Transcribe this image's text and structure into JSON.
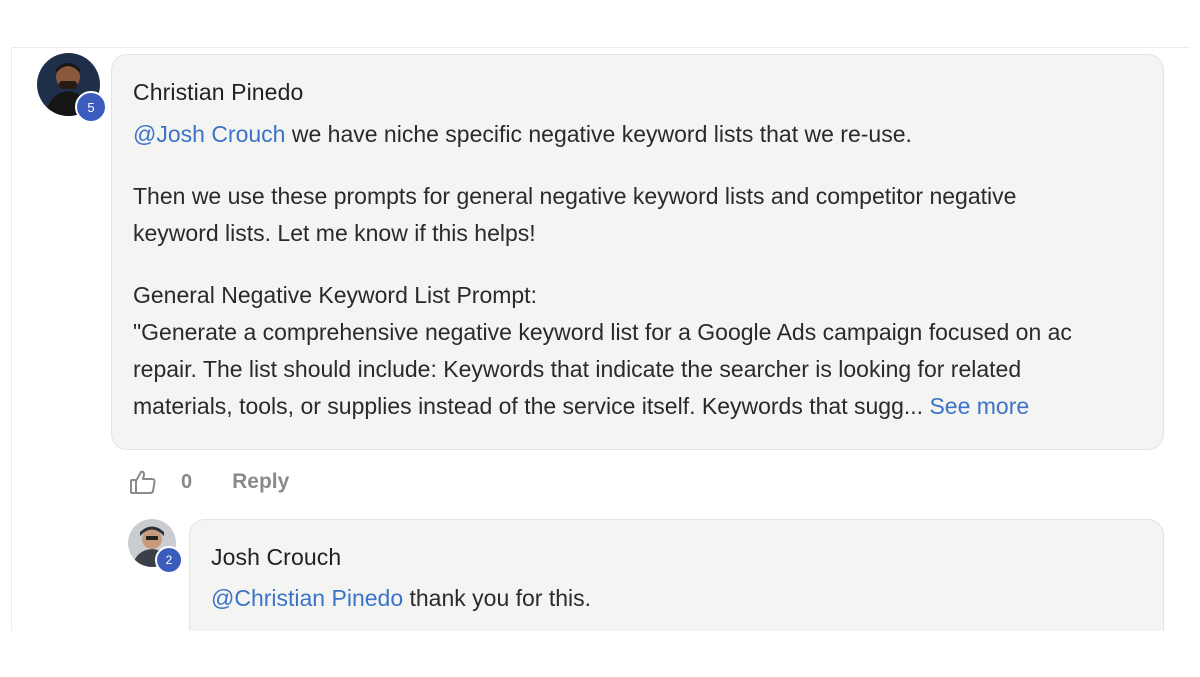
{
  "comments": [
    {
      "author": "Christian Pinedo",
      "level": "5",
      "mention": "@Josh Crouch",
      "paragraph1_rest": " we have niche specific negative keyword lists that we re-use.",
      "paragraph2_line1": "Then we use these prompts for general negative keyword lists and competitor negative",
      "paragraph2_line2": "keyword lists. Let me know if this helps!",
      "paragraph3_line1": "General Negative Keyword List Prompt:",
      "paragraph3_line2": "\"Generate a comprehensive negative keyword list for a Google Ads campaign focused on ac",
      "paragraph3_line3": "repair. The list should include: Keywords that indicate the searcher is looking for related",
      "paragraph3_line4": "materials, tools, or supplies instead of the service itself. Keywords that sugg... ",
      "see_more": "See more",
      "like_count": "0",
      "reply_label": "Reply",
      "like_icon": "thumbs-up-icon"
    },
    {
      "author": "Josh Crouch",
      "level": "2",
      "mention": "@Christian Pinedo",
      "text_rest": " thank you for this."
    }
  ],
  "colors": {
    "mention": "#3b73c8",
    "badge": "#3b5bbd",
    "bubble": "#f4f4f3"
  }
}
